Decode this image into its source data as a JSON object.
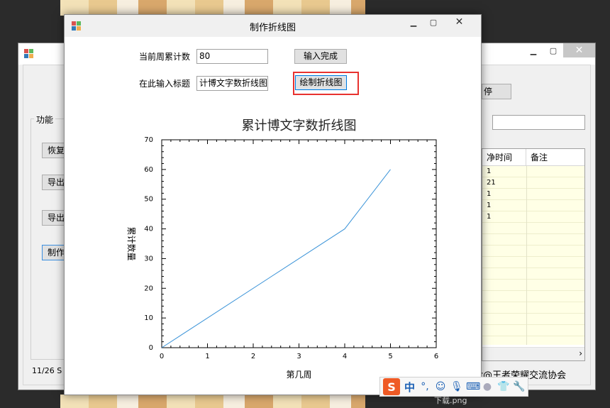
{
  "background_window": {
    "group_label": "功能",
    "buttons": [
      "恢复",
      "导出",
      "导出",
      "制作"
    ],
    "status_left": "11/26  S",
    "right_button_label": "停",
    "grid": {
      "columns": [
        "净时间",
        "备注"
      ],
      "rows": [
        "1",
        "21",
        "1",
        "1",
        "1"
      ]
    },
    "footer_text": "t@王者荣耀交流协会"
  },
  "dialog": {
    "title": "制作折线图",
    "label_weekly": "当前周累计数",
    "weekly_value": "80",
    "button_done": "输入完成",
    "label_title": "在此输入标题",
    "title_value": "计博文字数折线图",
    "button_draw": "绘制折线图"
  },
  "chart_data": {
    "type": "line",
    "title": "累计博文字数折线图",
    "xlabel": "第几周",
    "ylabel": "累计数量",
    "x": [
      0,
      4,
      5
    ],
    "series": [
      {
        "values": [
          0,
          40,
          60
        ]
      }
    ],
    "xlim": [
      0,
      6
    ],
    "ylim": [
      0,
      70
    ],
    "xticks": [
      "0",
      "1",
      "2",
      "3",
      "4",
      "5",
      "6"
    ],
    "yticks": [
      "0",
      "10",
      "20",
      "30",
      "40",
      "50",
      "60",
      "70"
    ],
    "line_color": "#3a93d8",
    "grid": false
  },
  "taskbar_caption": "下载.png",
  "ime": {
    "logo": "S",
    "lang": "中",
    "punct": "°,"
  }
}
